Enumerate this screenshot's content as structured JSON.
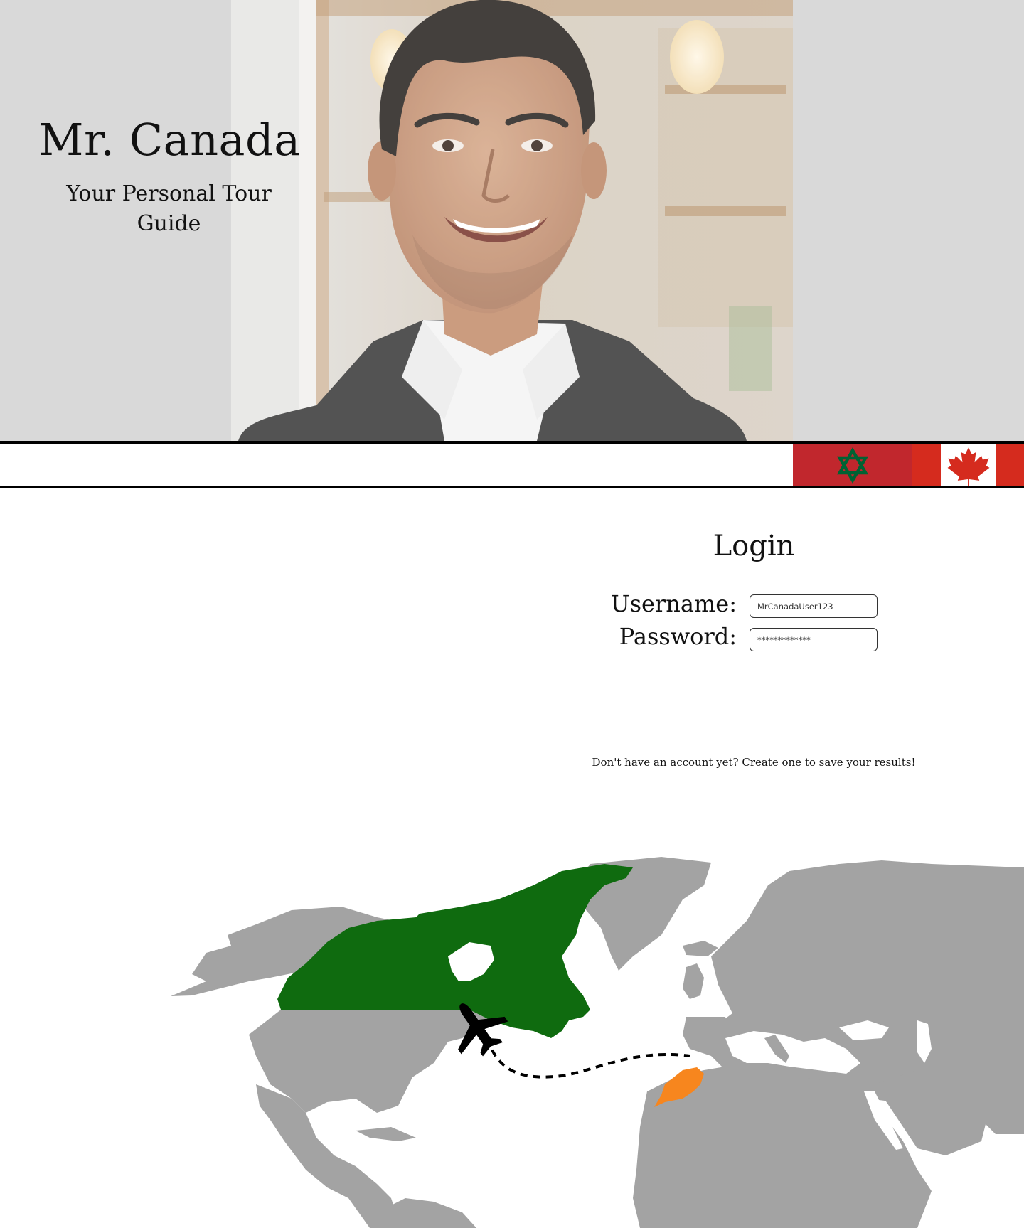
{
  "brand": {
    "title": "Mr. Canada",
    "subtitle": "Your Personal Tour Guide"
  },
  "flags": [
    "morocco-flag",
    "canada-flag"
  ],
  "login": {
    "title": "Login",
    "username_label": "Username:",
    "username_value": "MrCanadaUser123",
    "password_label": "Password:",
    "password_value": "*************"
  },
  "signup": {
    "text": "Don't have an account yet? Create one to save your results!"
  },
  "map": {
    "highlight_origin_color": "#0f6b0f",
    "highlight_destination_color": "#f7861e",
    "land_color": "#a3a3a3"
  },
  "colors": {
    "hero_bg": "#d9d9d9",
    "morocco_red": "#c1272d",
    "morocco_green": "#006233",
    "canada_red": "#d52b1e"
  }
}
